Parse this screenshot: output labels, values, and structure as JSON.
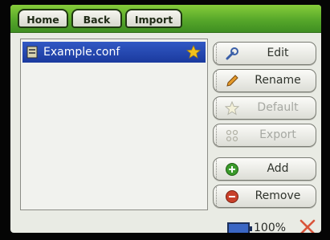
{
  "tabs": [
    {
      "label": "Home"
    },
    {
      "label": "Back"
    },
    {
      "label": "Import"
    }
  ],
  "file_list": {
    "items": [
      {
        "name": "Example.conf",
        "icon": "file-icon",
        "starred": true,
        "selected": true
      }
    ]
  },
  "actions": {
    "edit": "Edit",
    "rename": "Rename",
    "default": "Default",
    "export": "Export",
    "add": "Add",
    "remove": "Remove"
  },
  "status": {
    "battery": "100%"
  },
  "colors": {
    "topbar": "#5aa82c",
    "selection": "#2a4db8",
    "add": "#3a9a2a",
    "remove": "#c8402a",
    "close": "#d9543a"
  }
}
